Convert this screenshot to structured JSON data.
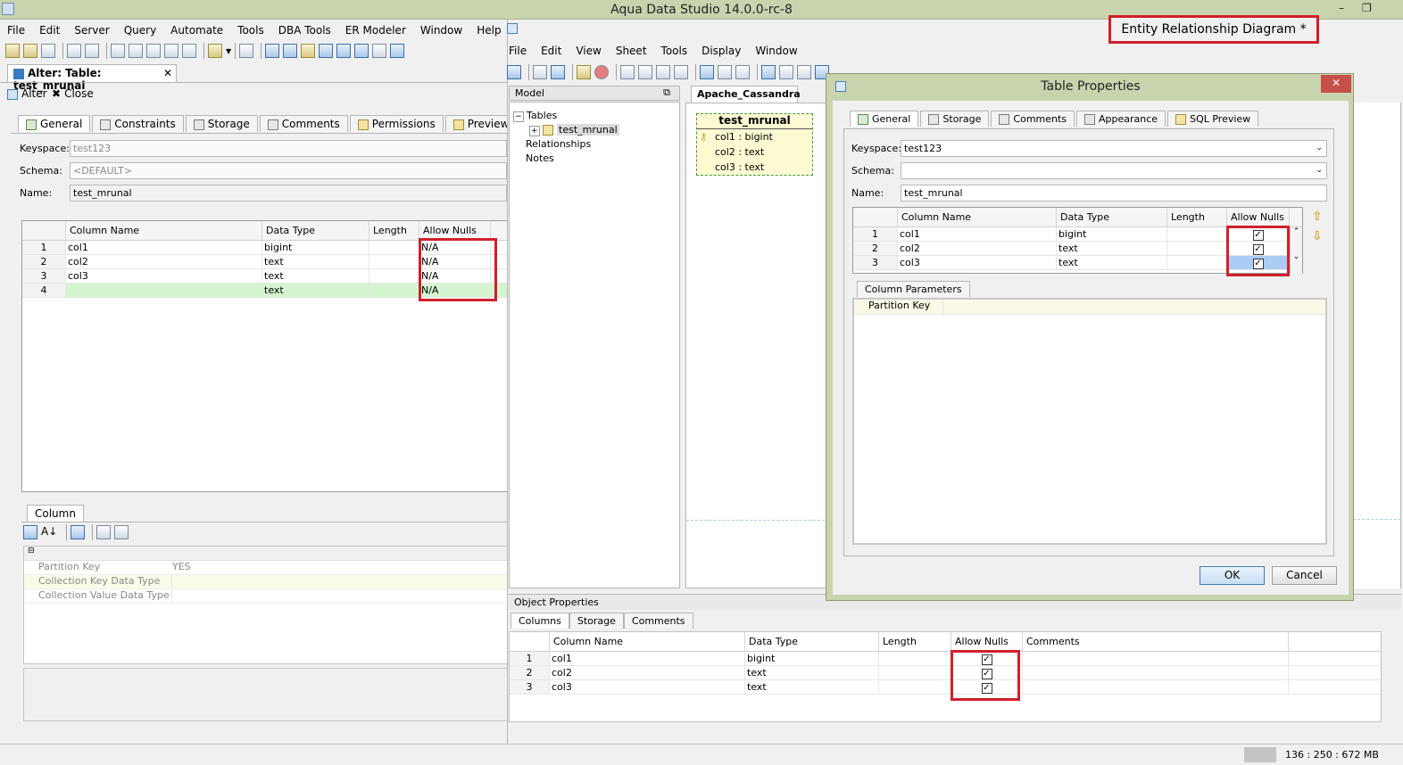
{
  "app": {
    "title": "Aqua Data Studio 14.0.0-rc-8"
  },
  "left": {
    "menu": [
      "File",
      "Edit",
      "Server",
      "Query",
      "Automate",
      "Tools",
      "DBA Tools",
      "ER Modeler",
      "Window",
      "Help"
    ],
    "doc_tab": "Alter: Table: test_mrunal",
    "actions": {
      "alter": "Alter",
      "close": "Close"
    },
    "tabs": [
      "General",
      "Constraints",
      "Storage",
      "Comments",
      "Permissions",
      "Preview SQL"
    ],
    "form": {
      "keyspace_label": "Keyspace:",
      "keyspace_value": "test123",
      "schema_label": "Schema:",
      "schema_value": "<DEFAULT>",
      "name_label": "Name:",
      "name_value": "test_mrunal"
    },
    "columns_header": [
      "Column Name",
      "Data Type",
      "Length",
      "Allow Nulls"
    ],
    "rows": [
      {
        "num": "1",
        "name": "col1",
        "type": "bigint",
        "length": "",
        "nulls": "N/A"
      },
      {
        "num": "2",
        "name": "col2",
        "type": "text",
        "length": "",
        "nulls": "N/A"
      },
      {
        "num": "3",
        "name": "col3",
        "type": "text",
        "length": "",
        "nulls": "N/A"
      },
      {
        "num": "4",
        "name": "",
        "type": "text",
        "length": "",
        "nulls": "N/A"
      }
    ],
    "column_tab": "Column",
    "props": [
      {
        "key": "Partition Key",
        "value": "YES"
      },
      {
        "key": "Collection Key Data Type",
        "value": ""
      },
      {
        "key": "Collection Value Data Type",
        "value": ""
      }
    ]
  },
  "er": {
    "badge": "Entity Relationship Diagram *",
    "menu": [
      "File",
      "Edit",
      "View",
      "Sheet",
      "Tools",
      "Display",
      "Window"
    ],
    "model_label": "Model",
    "tree": {
      "tables": "Tables",
      "table": "test_mrunal",
      "relationships": "Relationships",
      "notes": "Notes"
    },
    "canvas_tab": "Apache_Cassandra",
    "entity": {
      "title": "test_mrunal",
      "cols": [
        "col1 : bigint",
        "col2 : text",
        "col3 : text"
      ]
    },
    "object_props": "Object Properties",
    "obj_tabs": [
      "Columns",
      "Storage",
      "Comments"
    ],
    "obj_header": [
      "Column Name",
      "Data Type",
      "Length",
      "Allow Nulls",
      "Comments"
    ],
    "obj_rows": [
      {
        "num": "1",
        "name": "col1",
        "type": "bigint"
      },
      {
        "num": "2",
        "name": "col2",
        "type": "text"
      },
      {
        "num": "3",
        "name": "col3",
        "type": "text"
      }
    ]
  },
  "dialog": {
    "title": "Table Properties",
    "tabs": [
      "General",
      "Storage",
      "Comments",
      "Appearance",
      "SQL Preview"
    ],
    "keyspace_label": "Keyspace:",
    "keyspace_value": "test123",
    "schema_label": "Schema:",
    "schema_value": "",
    "name_label": "Name:",
    "name_value": "test_mrunal",
    "header": [
      "Column Name",
      "Data Type",
      "Length",
      "Allow Nulls"
    ],
    "rows": [
      {
        "num": "1",
        "name": "col1",
        "type": "bigint"
      },
      {
        "num": "2",
        "name": "col2",
        "type": "text"
      },
      {
        "num": "3",
        "name": "col3",
        "type": "text"
      }
    ],
    "column_params_tab": "Column Parameters",
    "partition_key": "Partition Key",
    "ok": "OK",
    "cancel": "Cancel"
  },
  "status": {
    "memory": "136 : 250 : 672 MB"
  }
}
